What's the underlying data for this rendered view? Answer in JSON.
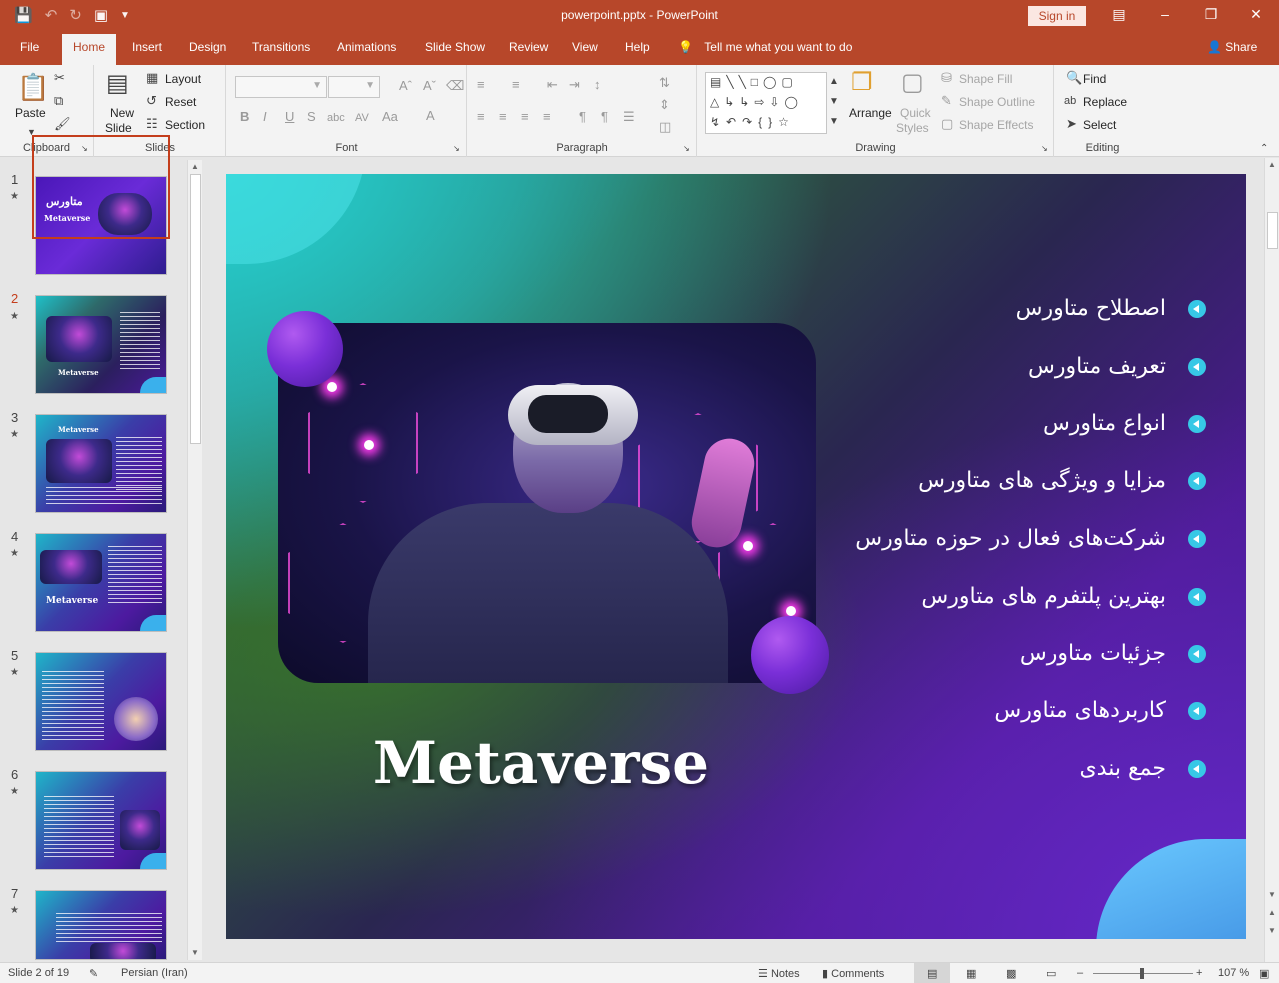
{
  "titlebar": {
    "title": "powerpoint.pptx  -  PowerPoint",
    "sign_in": "Sign in"
  },
  "tabs": [
    "File",
    "Home",
    "Insert",
    "Design",
    "Transitions",
    "Animations",
    "Slide Show",
    "Review",
    "View",
    "Help"
  ],
  "tell_me": "Tell me what you want to do",
  "share": "Share",
  "ribbon": {
    "clipboard": {
      "label": "Clipboard",
      "paste": "Paste"
    },
    "slides": {
      "label": "Slides",
      "new_slide_1": "New",
      "new_slide_2": "Slide",
      "layout": "Layout",
      "reset": "Reset",
      "section": "Section"
    },
    "font": {
      "label": "Font"
    },
    "paragraph": {
      "label": "Paragraph"
    },
    "drawing": {
      "label": "Drawing",
      "arrange": "Arrange",
      "quick_1": "Quick",
      "quick_2": "Styles",
      "shape_fill": "Shape Fill",
      "shape_outline": "Shape Outline",
      "shape_effects": "Shape Effects"
    },
    "editing": {
      "label": "Editing",
      "find": "Find",
      "replace": "Replace",
      "select": "Select"
    }
  },
  "thumbnails": {
    "numbers": [
      "1",
      "2",
      "3",
      "4",
      "5",
      "6",
      "7"
    ],
    "t1_title": "متاورس",
    "t1_sub": "Metaverse",
    "t2_title": "Metaverse",
    "t3_title": "Metaverse",
    "t4_title": "Metaverse"
  },
  "slide": {
    "title": "Metaverse",
    "bullets": [
      "اصطلاح متاورس",
      "تعریف متاورس",
      "انواع متاورس",
      "مزایا و ویژگی های متاورس",
      "شرکت‌های فعال در حوزه متاورس",
      "بهترین پلتفرم های متاورس",
      "جزئیات متاورس",
      "کاربردهای متاورس",
      "جمع بندی"
    ]
  },
  "status": {
    "slide_info": "Slide 2 of 19",
    "language": "Persian (Iran)",
    "notes": "Notes",
    "comments": "Comments",
    "zoom": "107 %"
  }
}
